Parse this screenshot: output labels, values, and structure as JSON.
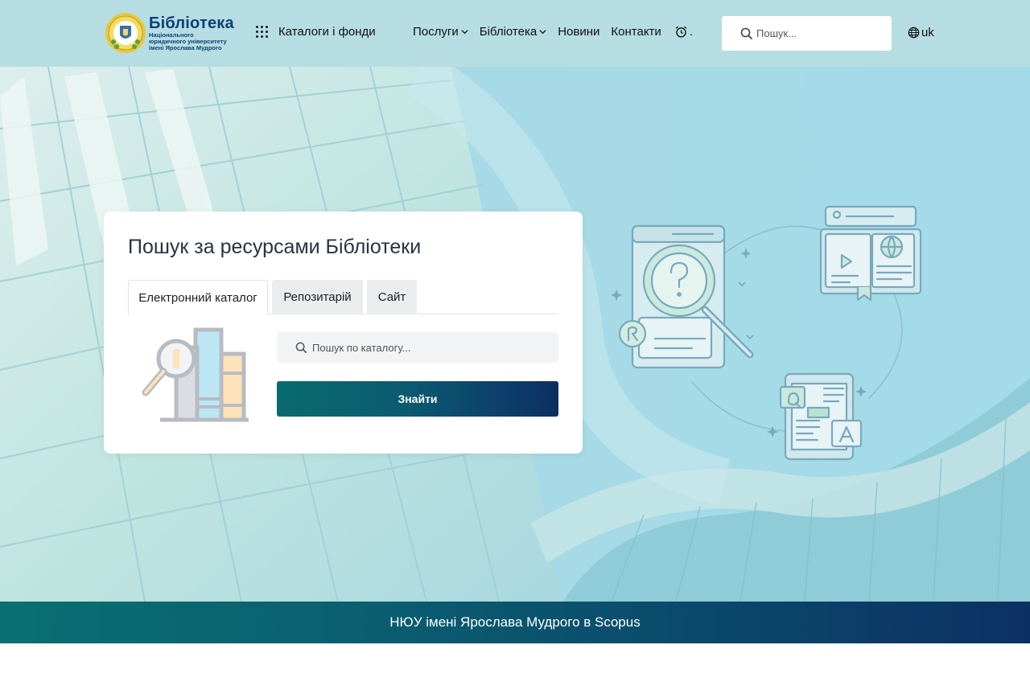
{
  "header": {
    "logo": {
      "title": "Бібліотека",
      "subtitle_lines": [
        "Національного",
        "юридичного університету",
        "імені Ярослава Мудрого"
      ]
    },
    "catalogs_label": "Каталоги і фонди",
    "nav": {
      "services": "Послуги",
      "library": "Бібліотека",
      "news": "Новини",
      "contacts": "Контакти",
      "hours_suffix": "."
    },
    "search": {
      "placeholder": "Пошук..."
    },
    "language": "uk"
  },
  "search_card": {
    "title": "Пошук за ресурсами Бібліотеки",
    "tabs": [
      {
        "label": "Електронний каталог",
        "active": true
      },
      {
        "label": "Репозитарій",
        "active": false
      },
      {
        "label": "Сайт",
        "active": false
      }
    ],
    "catalog_search": {
      "placeholder": "Пошук по каталогу..."
    },
    "submit_label": "Знайти"
  },
  "banner": {
    "text": "НЮУ імені Ярослава Мудрого в Scopus"
  },
  "colors": {
    "header_bg": "#b7dde2",
    "brand_blue": "#0d3f78",
    "button_gradient_start": "#086b6e",
    "button_gradient_end": "#0b2f60",
    "illustration_stroke": "#79a9bd",
    "illustration_accent": "#b9e3cf"
  }
}
